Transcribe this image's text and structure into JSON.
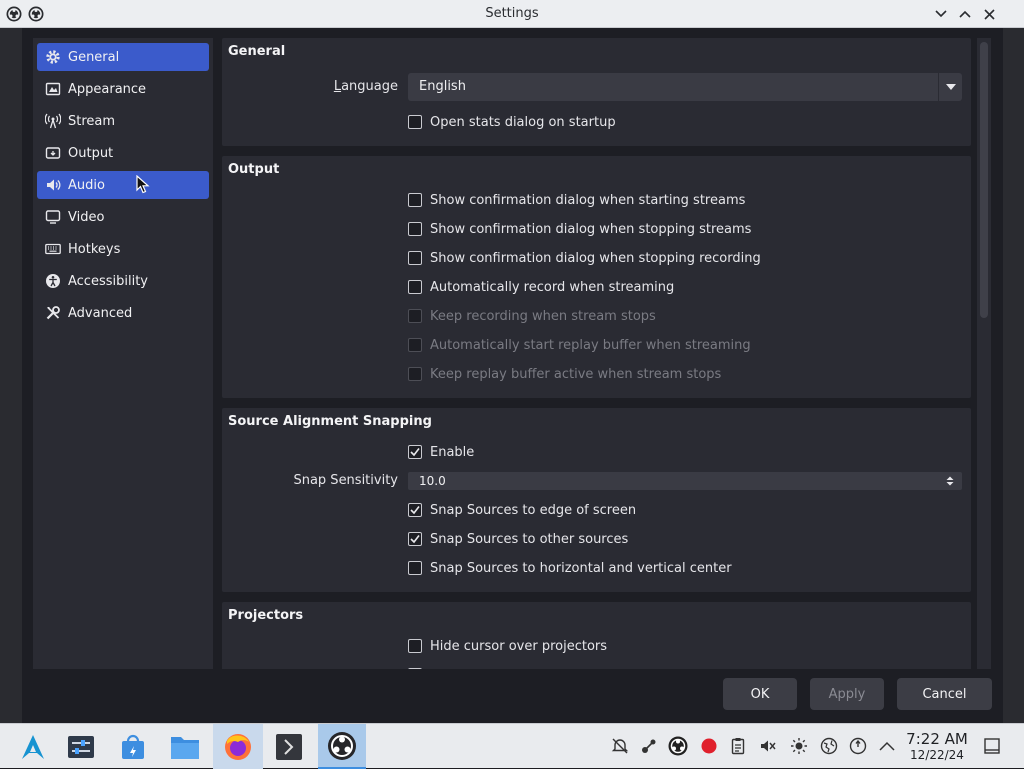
{
  "window": {
    "title": "Settings"
  },
  "sidebar": {
    "items": [
      {
        "label": "General",
        "icon": "gear-icon"
      },
      {
        "label": "Appearance",
        "icon": "appearance-icon"
      },
      {
        "label": "Stream",
        "icon": "antenna-icon"
      },
      {
        "label": "Output",
        "icon": "output-icon"
      },
      {
        "label": "Audio",
        "icon": "speaker-icon"
      },
      {
        "label": "Video",
        "icon": "monitor-icon"
      },
      {
        "label": "Hotkeys",
        "icon": "keyboard-icon"
      },
      {
        "label": "Accessibility",
        "icon": "accessibility-icon"
      },
      {
        "label": "Advanced",
        "icon": "tools-icon"
      }
    ]
  },
  "general": {
    "title": "General",
    "language_label": "Language",
    "language_value": "English",
    "stats_label": "Open stats dialog on startup"
  },
  "output": {
    "title": "Output",
    "options": [
      "Show confirmation dialog when starting streams",
      "Show confirmation dialog when stopping streams",
      "Show confirmation dialog when stopping recording",
      "Automatically record when streaming",
      "Keep recording when stream stops",
      "Automatically start replay buffer when streaming",
      "Keep replay buffer active when stream stops"
    ]
  },
  "snapping": {
    "title": "Source Alignment Snapping",
    "enable_label": "Enable",
    "sensitivity_label": "Snap Sensitivity",
    "sensitivity_value": "10.0",
    "options": [
      "Snap Sources to edge of screen",
      "Snap Sources to other sources",
      "Snap Sources to horizontal and vertical center"
    ]
  },
  "projectors": {
    "title": "Projectors",
    "hide_cursor_label": "Hide cursor over projectors"
  },
  "buttons": {
    "ok": "OK",
    "apply": "Apply",
    "cancel": "Cancel"
  },
  "clock": {
    "time": "7:22 AM",
    "date": "12/22/24"
  },
  "colors": {
    "accent": "#3b5bcb",
    "panel": "#2a2b33",
    "background": "#1d1e24"
  }
}
